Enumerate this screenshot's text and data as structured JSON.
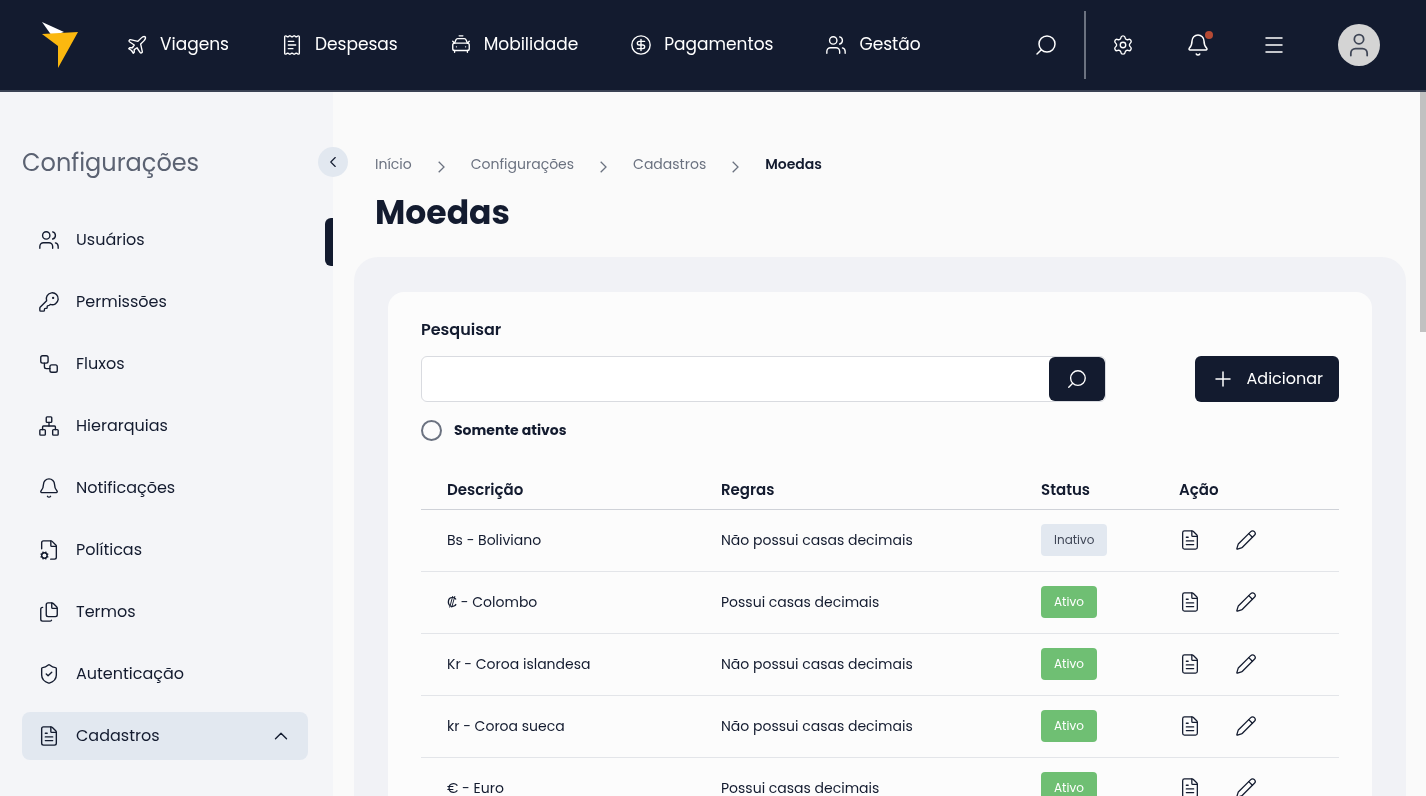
{
  "nav": [
    {
      "label": "Viagens"
    },
    {
      "label": "Despesas"
    },
    {
      "label": "Mobilidade"
    },
    {
      "label": "Pagamentos"
    },
    {
      "label": "Gestão"
    }
  ],
  "notifications": {
    "unread": true
  },
  "sidebar": {
    "title": "Configurações",
    "items": [
      {
        "label": "Usuários",
        "selected": false
      },
      {
        "label": "Permissões",
        "selected": false
      },
      {
        "label": "Fluxos",
        "selected": false
      },
      {
        "label": "Hierarquias",
        "selected": false
      },
      {
        "label": "Notificações",
        "selected": false
      },
      {
        "label": "Políticas",
        "selected": false
      },
      {
        "label": "Termos",
        "selected": false
      },
      {
        "label": "Autenticação",
        "selected": false
      },
      {
        "label": "Cadastros",
        "selected": true,
        "expanded": true
      }
    ]
  },
  "breadcrumb": [
    "Início",
    "Configurações",
    "Cadastros",
    "Moedas"
  ],
  "page_title": "Moedas",
  "search": {
    "label": "Pesquisar"
  },
  "add_button": "Adicionar",
  "only_active": {
    "label": "Somente ativos",
    "checked": false
  },
  "table": {
    "columns": [
      "Descrição",
      "Regras",
      "Status",
      "Ação"
    ],
    "rows": [
      {
        "description": "Bs - Boliviano",
        "rules": "Não possui casas decimais",
        "status": "Inativo",
        "active": false
      },
      {
        "description": "₡ - Colombo",
        "rules": "Possui casas decimais",
        "status": "Ativo",
        "active": true
      },
      {
        "description": "Kr - Coroa islandesa",
        "rules": "Não possui casas decimais",
        "status": "Ativo",
        "active": true
      },
      {
        "description": "kr - Coroa sueca",
        "rules": "Não possui casas decimais",
        "status": "Ativo",
        "active": true
      },
      {
        "description": "€ - Euro",
        "rules": "Possui casas decimais",
        "status": "Ativo",
        "active": true
      }
    ]
  }
}
